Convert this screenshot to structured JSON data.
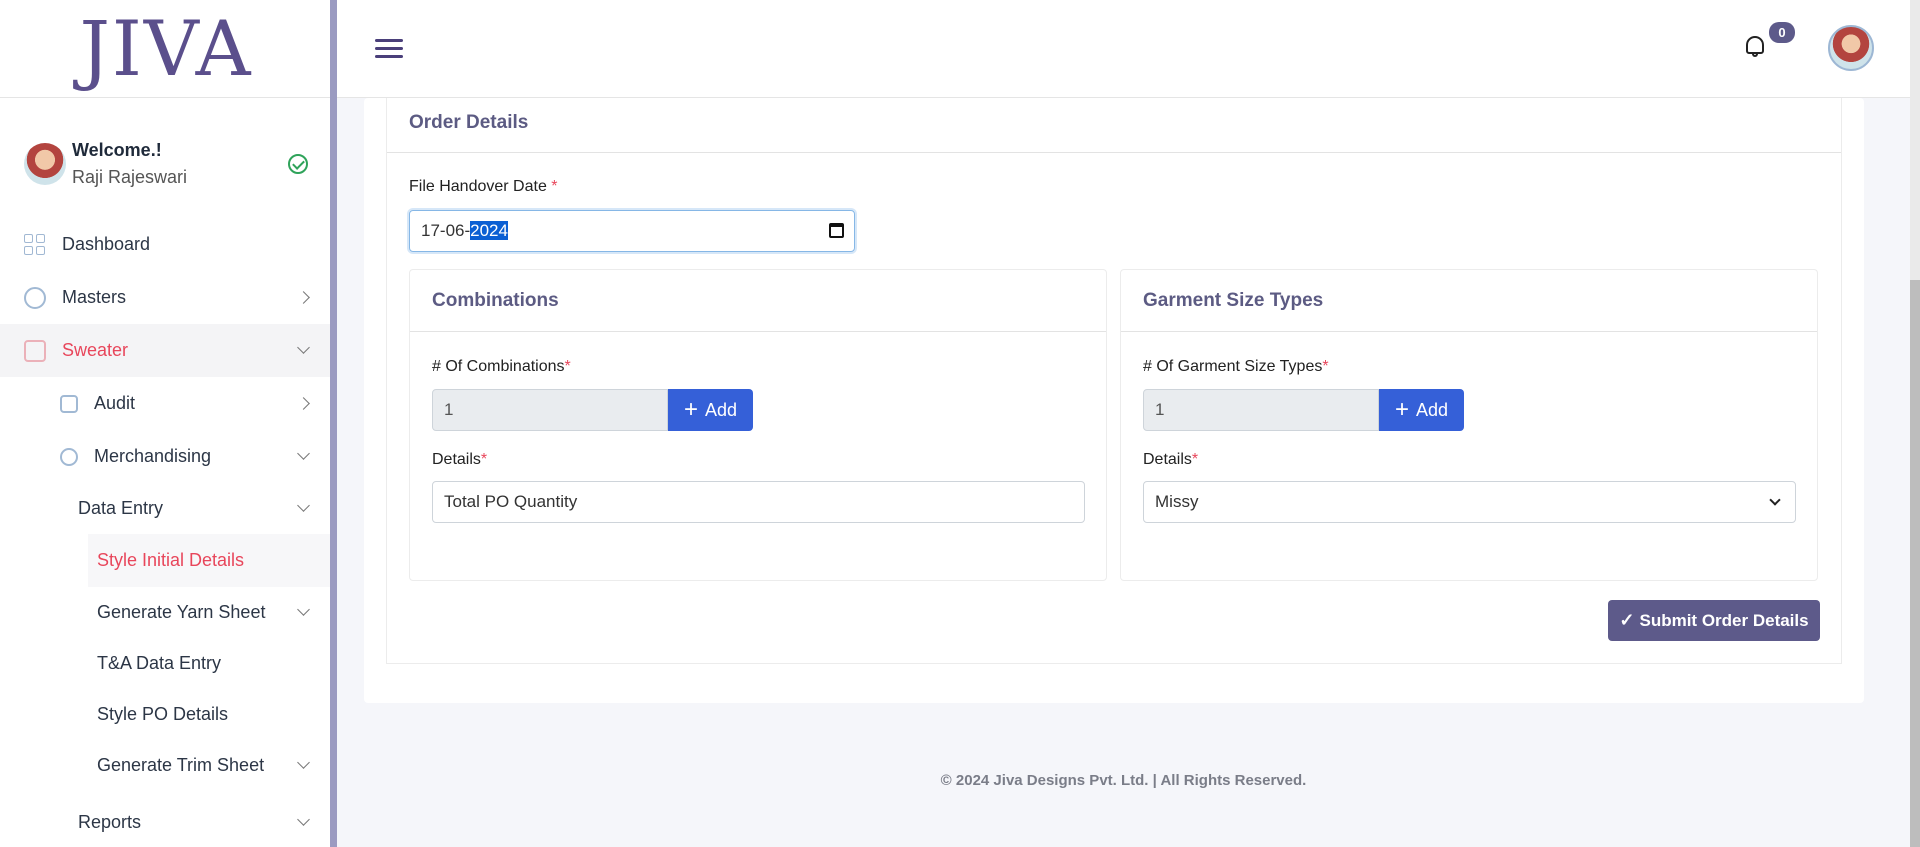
{
  "brand": {
    "logo_text": "JIVA"
  },
  "user": {
    "welcome": "Welcome.!",
    "name": "Raji Rajeswari"
  },
  "sidebar": {
    "items": [
      {
        "label": "Dashboard"
      },
      {
        "label": "Masters"
      },
      {
        "label": "Sweater"
      },
      {
        "label": "Audit"
      },
      {
        "label": "Merchandising"
      },
      {
        "label": "Data Entry"
      },
      {
        "label": "Style Initial Details"
      },
      {
        "label": "Generate Yarn Sheet"
      },
      {
        "label": "T&A Data Entry"
      },
      {
        "label": "Style PO Details"
      },
      {
        "label": "Generate Trim Sheet"
      },
      {
        "label": "Reports"
      }
    ]
  },
  "topbar": {
    "notification_count": "0"
  },
  "order_details": {
    "title": "Order Details",
    "file_handover_label": "File Handover Date",
    "required_mark": "*",
    "date_prefix": "17-06-",
    "date_selected": "2024",
    "combinations": {
      "title": "Combinations",
      "count_label": "# Of Combinations",
      "count_value": "1",
      "add_label": "Add",
      "details_label": "Details",
      "details_value": "Total PO Quantity"
    },
    "garment_sizes": {
      "title": "Garment Size Types",
      "count_label": "# Of Garment Size Types",
      "count_value": "1",
      "add_label": "Add",
      "details_label": "Details",
      "details_value": "Missy"
    },
    "submit_label": "Submit Order Details"
  },
  "footer": {
    "text": "© 2024 Jiva Designs Pvt. Ltd. | All Rights Reserved."
  },
  "colors": {
    "accent": "#5d5a8a",
    "primary": "#3560d8",
    "danger": "#e8465b"
  }
}
